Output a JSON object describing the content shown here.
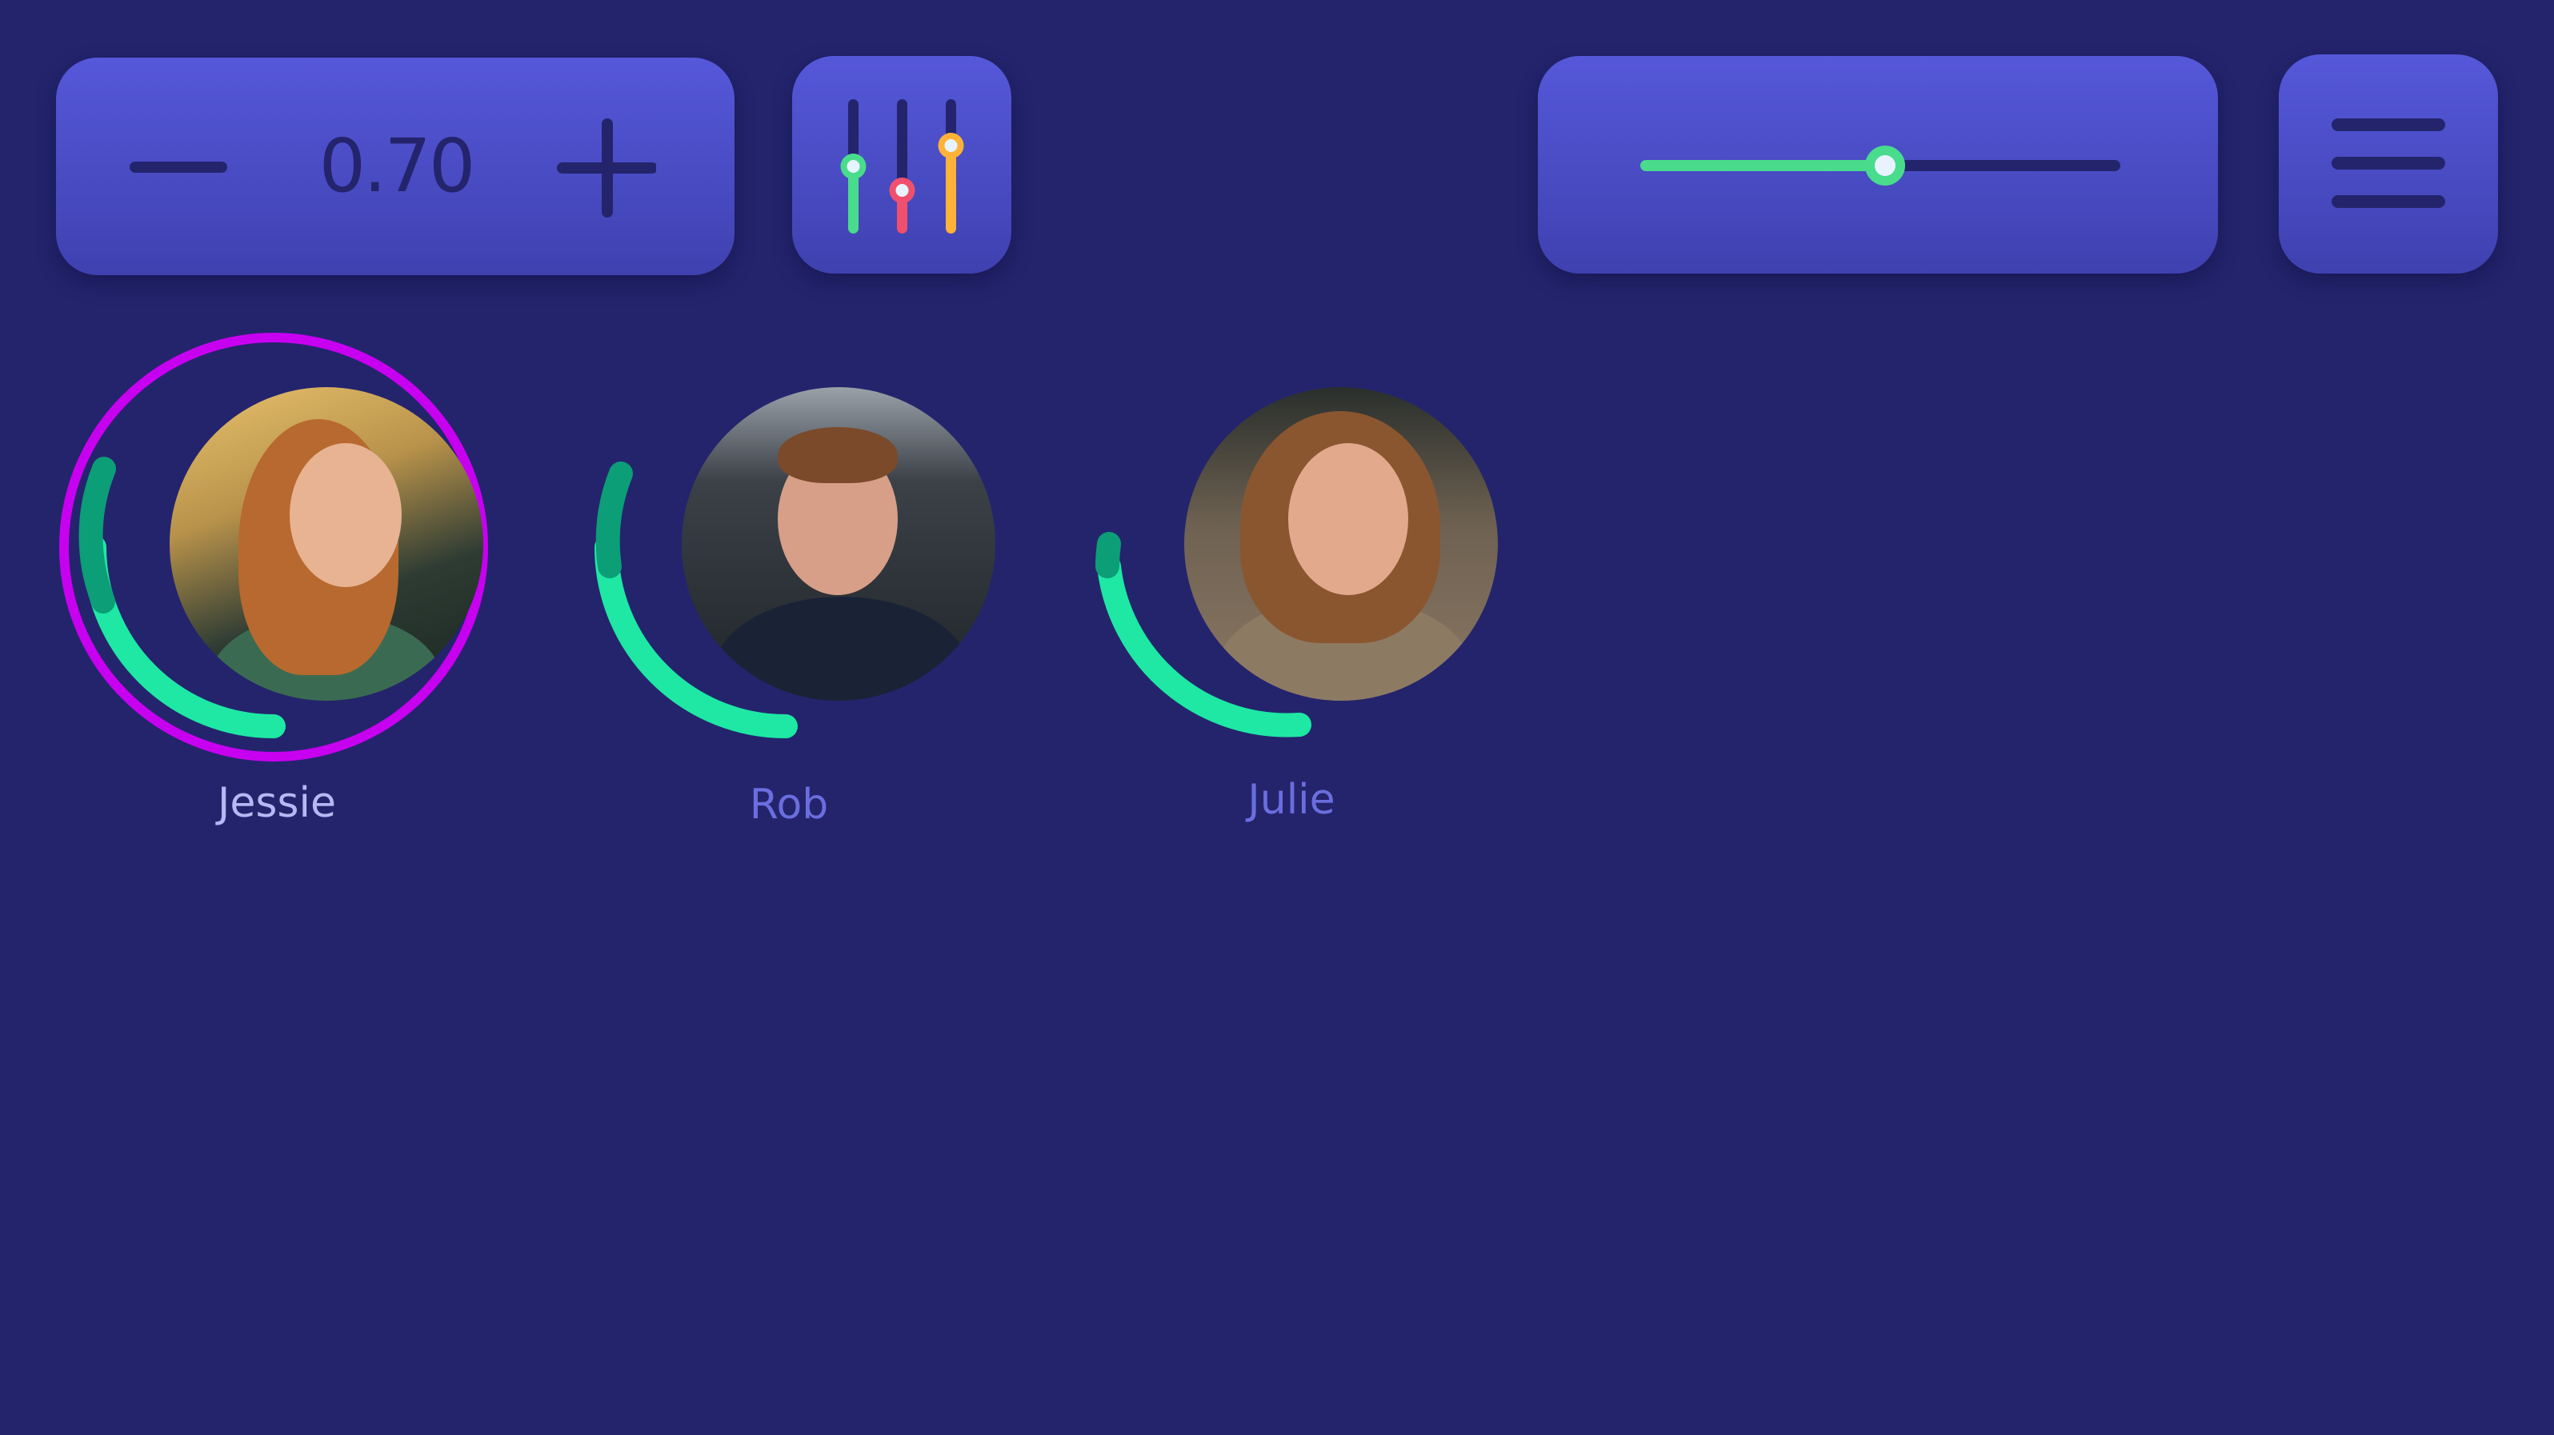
{
  "toolbar": {
    "stepper": {
      "value": "0.70",
      "decrement_icon": "minus-icon",
      "increment_icon": "plus-icon"
    },
    "mixer_icon": "equalizer-sliders-icon",
    "mixer_colors": [
      "#48dc8c",
      "#f0506e",
      "#ffb238"
    ],
    "volume": {
      "level": 0.51,
      "fill_color": "#48dc8c"
    },
    "menu_icon": "hamburger-menu-icon"
  },
  "participants": [
    {
      "name": "Jessie",
      "selected": true,
      "level": 0.33,
      "avatar": "participant-photo"
    },
    {
      "name": "Rob",
      "selected": false,
      "level": 0.34,
      "avatar": "participant-photo"
    },
    {
      "name": "Julie",
      "selected": false,
      "level": 0.25,
      "avatar": "participant-photo"
    }
  ],
  "colors": {
    "background": "#24246d",
    "panel": "#4f51cf",
    "accent_green": "#1ee8a4",
    "selected_ring": "#c800f0"
  }
}
